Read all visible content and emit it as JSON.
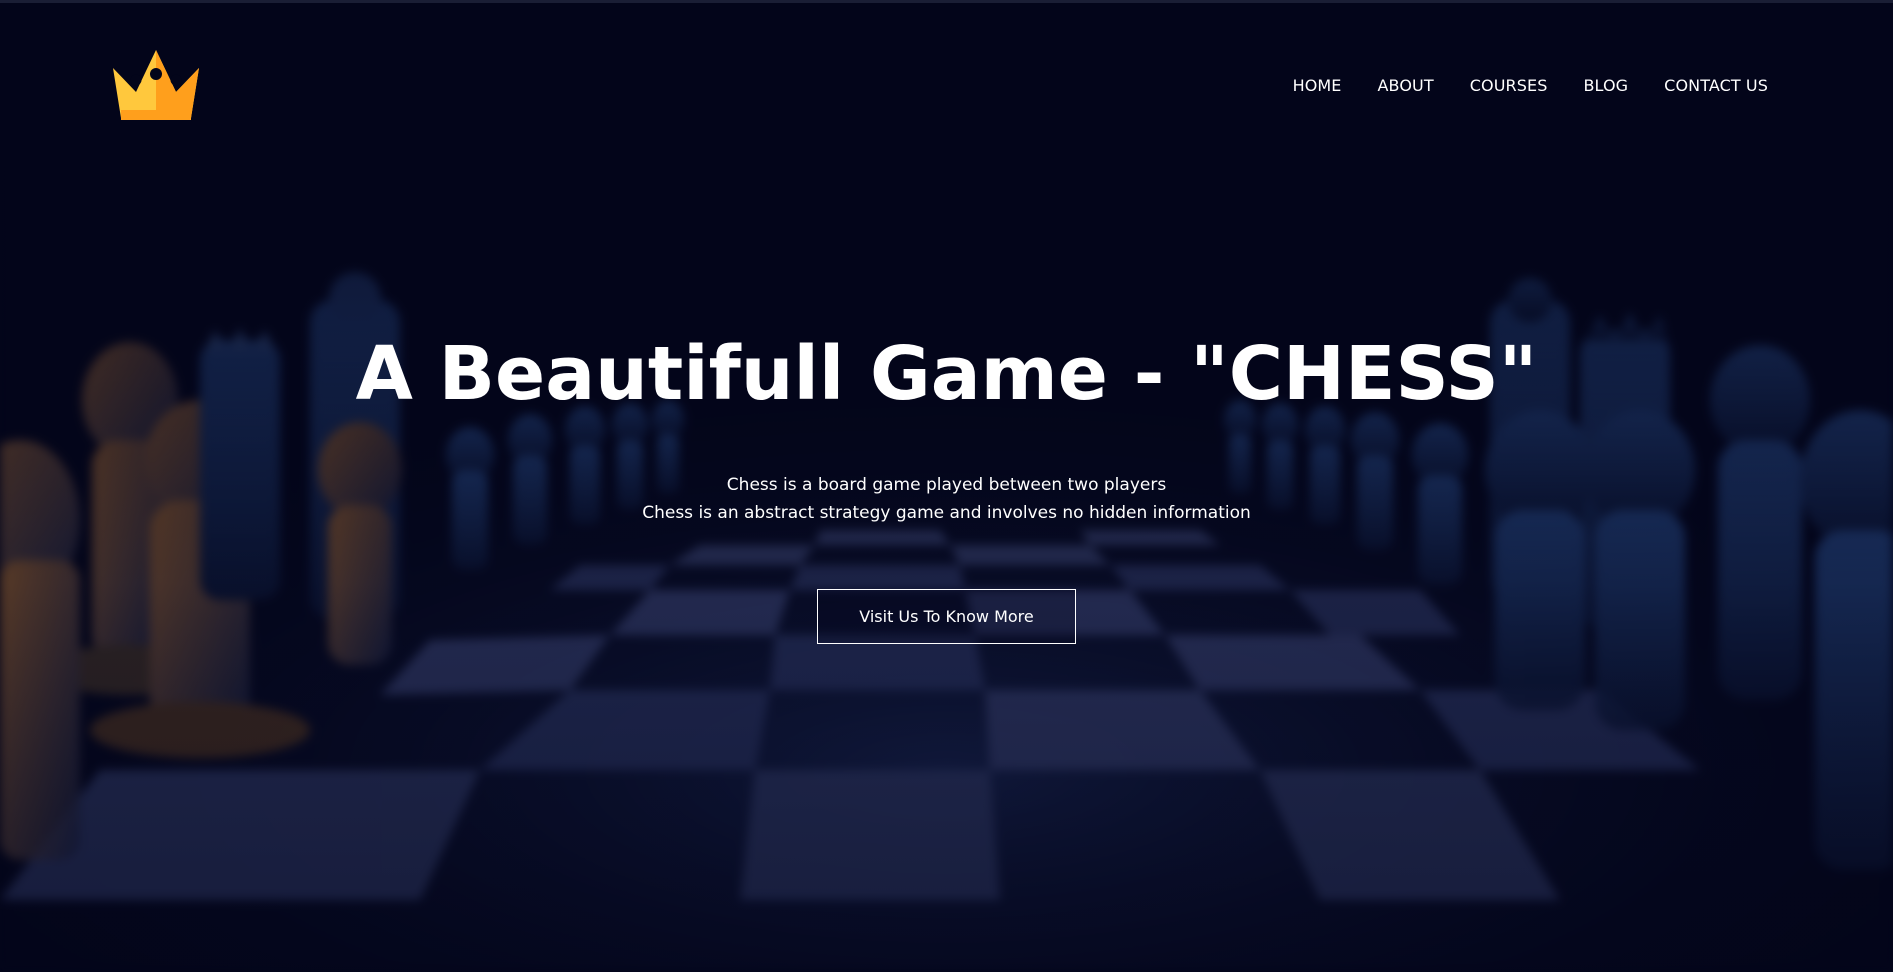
{
  "header": {
    "logo_icon": "crown-icon",
    "nav": {
      "items": [
        {
          "label": "HOME"
        },
        {
          "label": "ABOUT"
        },
        {
          "label": "COURSES"
        },
        {
          "label": "BLOG"
        },
        {
          "label": "CONTACT US"
        }
      ]
    }
  },
  "hero": {
    "title": "A Beautifull Game - \"CHESS\"",
    "subtitle_lines": [
      "Chess is a board game played between two players",
      "Chess is an abstract strategy game and involves no hidden information"
    ],
    "cta_label": "Visit Us To Know More",
    "background": "chessboard-with-pieces-image"
  },
  "colors": {
    "background": "#03051a",
    "text": "#ffffff",
    "logo_gold": "#ffc83d",
    "logo_orange": "#ff9f1c",
    "piece_blue": "#1f3f7a",
    "piece_bronze": "#8a5a2b"
  }
}
